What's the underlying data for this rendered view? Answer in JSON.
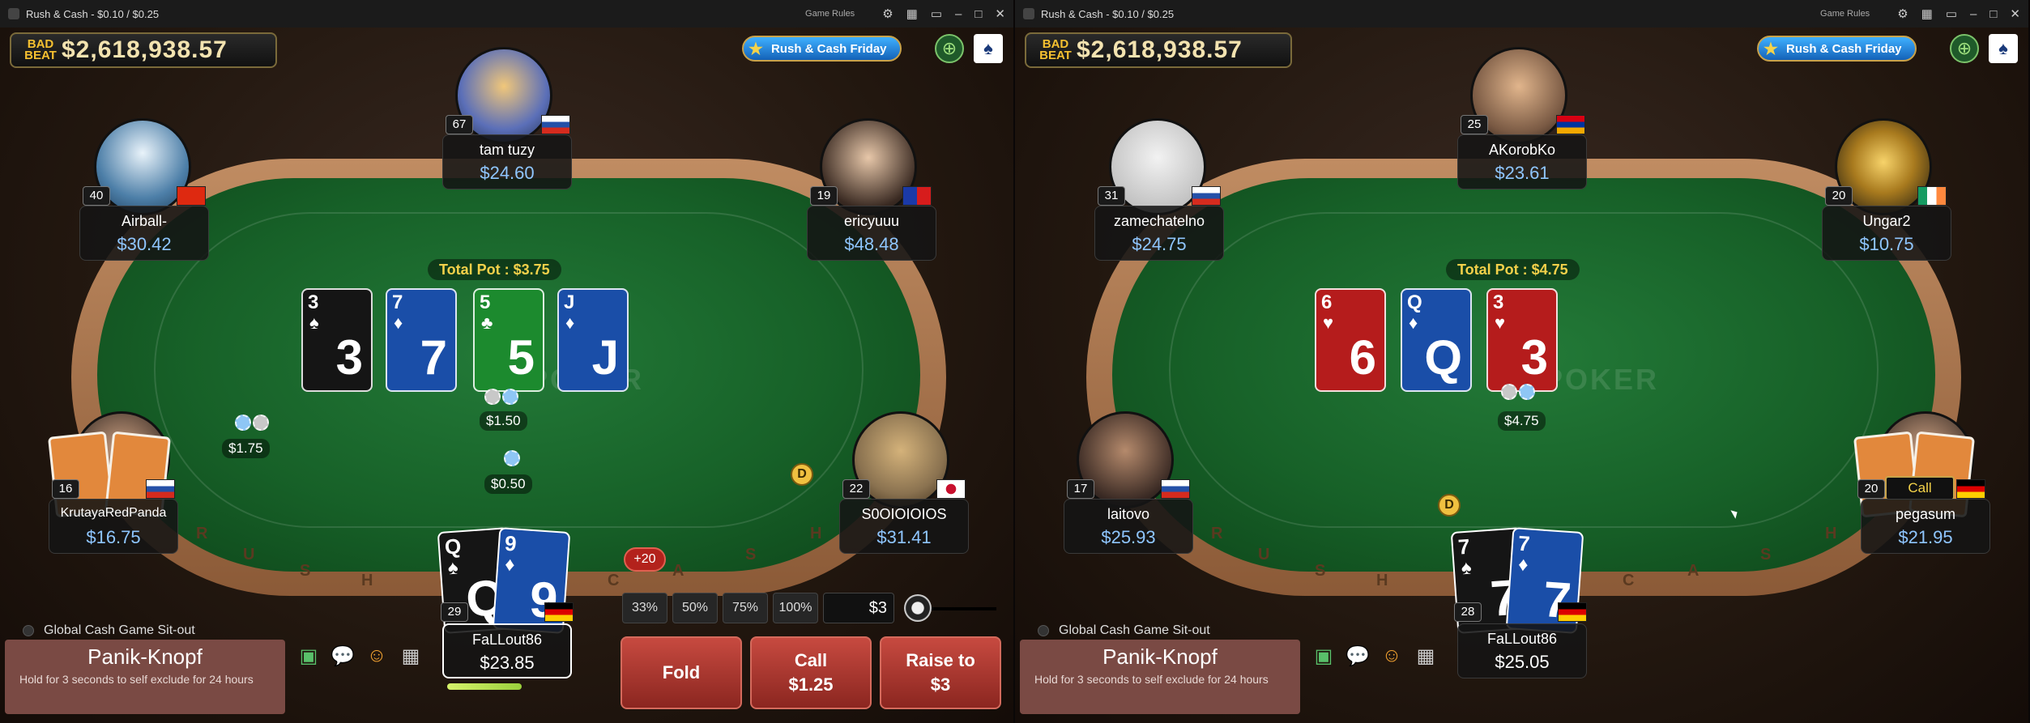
{
  "left": {
    "title": "Rush & Cash - $0.10 / $0.25",
    "game_rules": "Game Rules",
    "jackpot_brand": "BAD BEAT",
    "jackpot_amount": "$2,618,938.57",
    "promo": "Rush & Cash Friday",
    "total_pot": "Total Pot : $3.75",
    "watermark": "GGPOKER",
    "board": [
      {
        "rank": "3",
        "suit": "♠",
        "color": "black"
      },
      {
        "rank": "7",
        "suit": "♦",
        "color": "blue"
      },
      {
        "rank": "5",
        "suit": "♣",
        "color": "green"
      },
      {
        "rank": "J",
        "suit": "♦",
        "color": "blue"
      }
    ],
    "bets": {
      "center": "$1.50",
      "left": "$1.75",
      "below": "$0.50"
    },
    "dealer": "D",
    "seats": {
      "top": {
        "name": "tam tuzy",
        "stack": "$24.60",
        "level": "67",
        "flag": "RU"
      },
      "top_left": {
        "name": "Airball-",
        "stack": "$30.42",
        "level": "40",
        "flag": "CN"
      },
      "top_right": {
        "name": "ericyuuu",
        "stack": "$48.48",
        "level": "19",
        "flag": "TW"
      },
      "mid_left": {
        "name": "KrutayaRedPanda",
        "stack": "$16.75",
        "level": "16",
        "flag": "RU"
      },
      "mid_right": {
        "name": "S0OIOIOIOS",
        "stack": "$31.41",
        "level": "22",
        "flag": "JP"
      },
      "hero": {
        "name": "FaLLout86",
        "stack": "$23.85",
        "level": "29",
        "flag": "DE"
      }
    },
    "hero_cards": [
      {
        "rank": "Q",
        "suit": "♠",
        "color": "black"
      },
      {
        "rank": "9",
        "suit": "♦",
        "color": "blue"
      }
    ],
    "plus20": "+20",
    "presets": [
      "33%",
      "50%",
      "75%",
      "100%"
    ],
    "bet_value": "$3",
    "actions": {
      "fold": "Fold",
      "call": "Call",
      "call_amount": "$1.25",
      "raise": "Raise to",
      "raise_amount": "$3"
    },
    "time_bank_fraction": 0.6,
    "sitout": "Global Cash Game Sit-out",
    "panic_title": "Panik-Knopf",
    "panic_sub": "Hold for 3 seconds to self exclude for 24 hours",
    "rail_text": [
      "R",
      "U",
      "S",
      "H",
      "$",
      "C",
      "A",
      "S",
      "H"
    ]
  },
  "right": {
    "title": "Rush & Cash - $0.10 / $0.25",
    "game_rules": "Game Rules",
    "jackpot_brand": "BAD BEAT",
    "jackpot_amount": "$2,618,938.57",
    "promo": "Rush & Cash Friday",
    "total_pot": "Total Pot : $4.75",
    "watermark": "GGPOKER",
    "board": [
      {
        "rank": "6",
        "suit": "♥",
        "color": "red"
      },
      {
        "rank": "Q",
        "suit": "♦",
        "color": "blue"
      },
      {
        "rank": "3",
        "suit": "♥",
        "color": "red"
      }
    ],
    "bets": {
      "center": "$4.75"
    },
    "dealer": "D",
    "seats": {
      "top": {
        "name": "AKorobKo",
        "stack": "$23.61",
        "level": "25",
        "flag": "AM"
      },
      "top_left": {
        "name": "zamechatelno",
        "stack": "$24.75",
        "level": "31",
        "flag": "RU"
      },
      "top_right": {
        "name": "Ungar2",
        "stack": "$10.75",
        "level": "20",
        "flag": "IE"
      },
      "mid_left": {
        "name": "laitovo",
        "stack": "$25.93",
        "level": "17",
        "flag": "RU"
      },
      "mid_right": {
        "name": "pegasum",
        "stack": "$21.95",
        "level": "20",
        "flag": "DE",
        "badge": "Call"
      },
      "hero": {
        "name": "FaLLout86",
        "stack": "$25.05",
        "level": "28",
        "flag": "DE"
      }
    },
    "hero_cards": [
      {
        "rank": "7",
        "suit": "♠",
        "color": "black"
      },
      {
        "rank": "7",
        "suit": "♦",
        "color": "blue"
      }
    ],
    "sitout": "Global Cash Game Sit-out",
    "panic_title": "Panik-Knopf",
    "panic_sub": "Hold for 3 seconds to self exclude for 24 hours",
    "rail_text": [
      "R",
      "U",
      "S",
      "H",
      "$",
      "C",
      "A",
      "S",
      "H"
    ]
  },
  "icons": {
    "settings": "gear-icon",
    "layout": "grid-icon",
    "chat": "chat-icon",
    "add": "plus-icon",
    "cards": "cards-icon",
    "video": "video-icon",
    "emoji": "emoji-icon",
    "calc": "calculator-icon"
  },
  "colors": {
    "felt": "#176128",
    "rail": "#b07a50",
    "stack_text": "#8fc6ff",
    "pot_text": "#f3d04a",
    "action_red": "#b3332a"
  }
}
